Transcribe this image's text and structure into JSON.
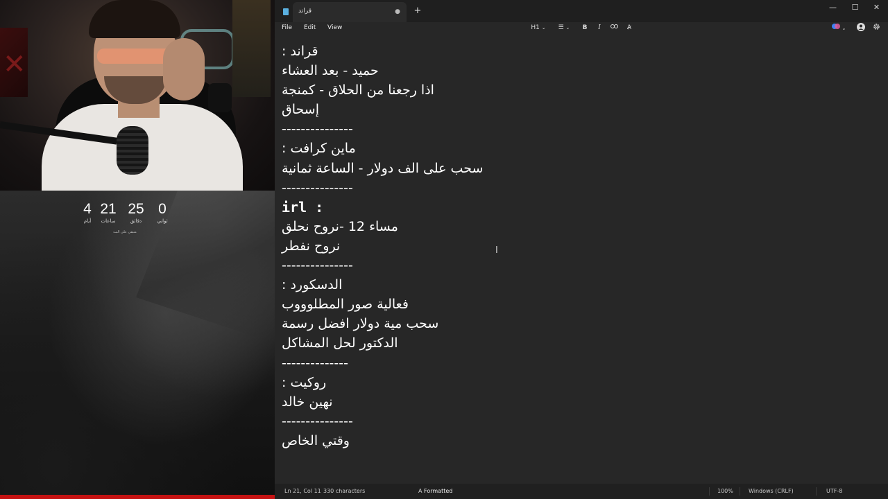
{
  "countdown": {
    "days": {
      "value": "4",
      "label": "أيام"
    },
    "hours": {
      "value": "21",
      "label": "ساعات"
    },
    "minutes": {
      "value": "25",
      "label": "دقائق"
    },
    "seconds": {
      "value": "0",
      "label": "ثواني"
    },
    "caption": "متبقي على البث"
  },
  "window": {
    "tab_title": "قراند",
    "new_tab": "+",
    "minimize": "—",
    "maximize": "☐",
    "close": "✕"
  },
  "menu": {
    "file": "File",
    "edit": "Edit",
    "view": "View"
  },
  "toolbar": {
    "heading": "H1",
    "list": "☰",
    "bold": "B",
    "italic": "I",
    "link": "🔗",
    "clear_format": "A̷"
  },
  "document": {
    "lines": [
      "قراند :",
      "حميد - بعد العشاء",
      "اذا رجعنا من الحلاق - كمنجة",
      "إسحاق",
      "---------------",
      "ماين كرافت :",
      "سحب على الف دولار - الساعة ثمانية",
      "---------------",
      "irl :",
      " مساء 12 -نروح نحلق",
      "نروح نفطر",
      "---------------",
      "الدسكورد :",
      "فعالية صور المطلوووب",
      "سحب مية دولار افضل رسمة",
      "الدكتور لحل المشاكل",
      "--------------",
      " روكيت :",
      "نهين خالد",
      "---------------",
      "وقتي الخاص"
    ]
  },
  "status": {
    "position": "Ln 21, Col 11",
    "characters": "330 characters",
    "format": "Formatted",
    "zoom": "100%",
    "line_endings": "Windows (CRLF)",
    "encoding": "UTF-8"
  },
  "colors": {
    "accent_red": "#c41212",
    "editor_bg": "#272727",
    "titlebar_bg": "#1f1f1f"
  }
}
